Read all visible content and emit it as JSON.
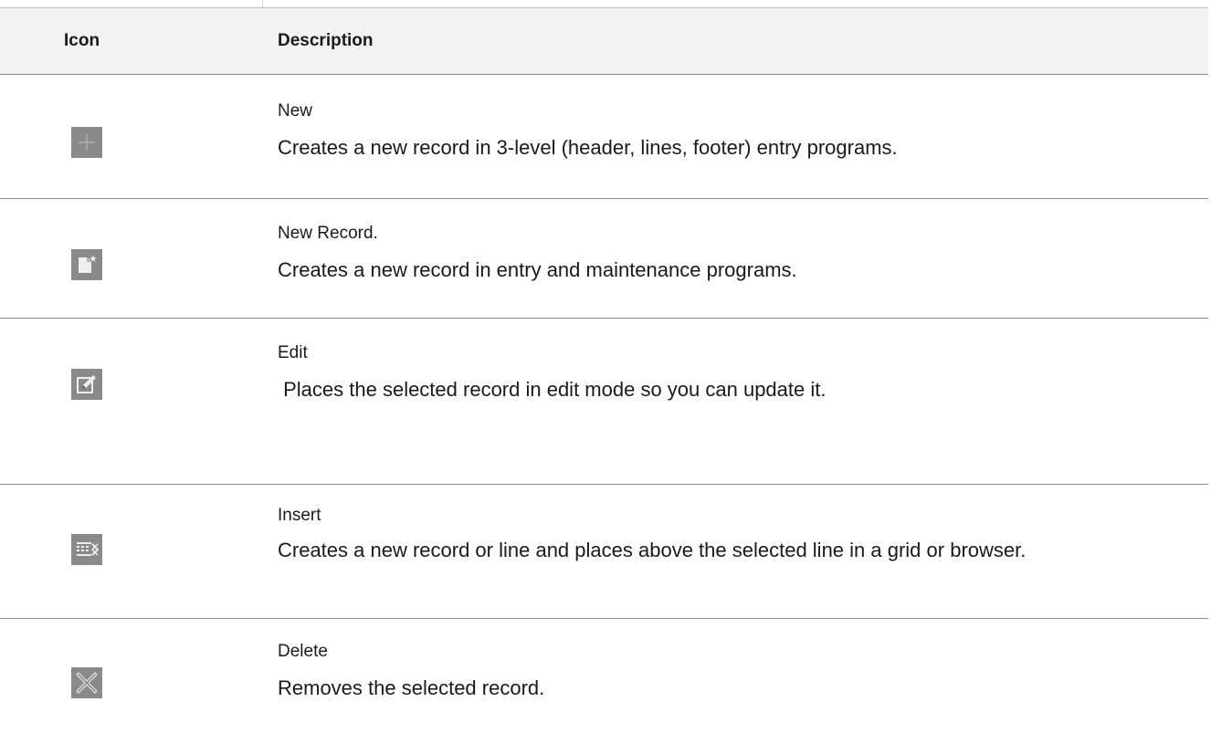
{
  "table": {
    "headers": {
      "icon": "Icon",
      "description": "Description"
    },
    "rows": [
      {
        "icon": "plus-icon",
        "title": "New",
        "text": "Creates a new record in 3-level (header, lines, footer) entry programs."
      },
      {
        "icon": "new-record-icon",
        "title": "New Record.",
        "text": "Creates a new record in entry and maintenance programs."
      },
      {
        "icon": "edit-pencil-icon",
        "title": "Edit",
        "text": " Places the selected record in edit mode so you can update it."
      },
      {
        "icon": "insert-line-icon",
        "title": "Insert",
        "text": "Creates a new record or line and places above the selected line in a grid or browser."
      },
      {
        "icon": "delete-x-icon",
        "title": "Delete",
        "text": "Removes the selected record."
      }
    ]
  },
  "colors": {
    "icon_bg": "#8a8a8a",
    "icon_fg": "#e8e8e8",
    "header_bg": "#f2f2f2",
    "rule": "#8c8c8c"
  }
}
